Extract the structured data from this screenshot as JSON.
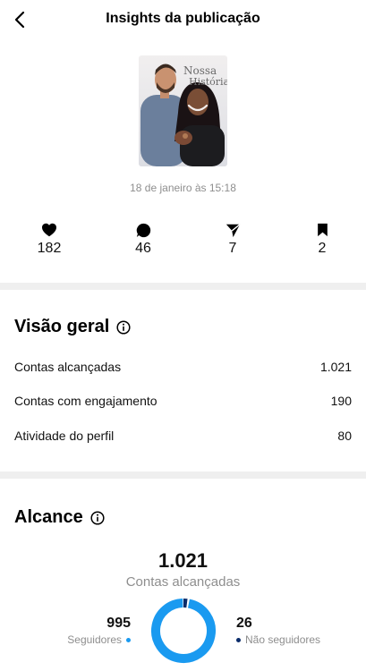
{
  "header": {
    "title": "Insights da publicação",
    "back_icon": "chevron-left-icon"
  },
  "post": {
    "thumbnail_text_line1": "Nossa",
    "thumbnail_text_line2": "História",
    "date": "18 de janeiro às 15:18"
  },
  "stats": [
    {
      "icon": "heart-icon",
      "value": "182"
    },
    {
      "icon": "comment-icon",
      "value": "46"
    },
    {
      "icon": "share-icon",
      "value": "7"
    },
    {
      "icon": "bookmark-icon",
      "value": "2"
    }
  ],
  "overview": {
    "title": "Visão geral",
    "rows": [
      {
        "label": "Contas alcançadas",
        "value": "1.021"
      },
      {
        "label": "Contas com engajamento",
        "value": "190"
      },
      {
        "label": "Atividade do perfil",
        "value": "80"
      }
    ]
  },
  "reach": {
    "title": "Alcance",
    "total": "1.021",
    "caption": "Contas alcançadas",
    "followers": {
      "value": "995",
      "label": "Seguidores",
      "fraction": 0.9745
    },
    "non_followers": {
      "value": "26",
      "label": "Não seguidores",
      "fraction": 0.0255
    },
    "colors": {
      "followers": "#1a9af0",
      "non_followers": "#0b2c6a"
    }
  }
}
